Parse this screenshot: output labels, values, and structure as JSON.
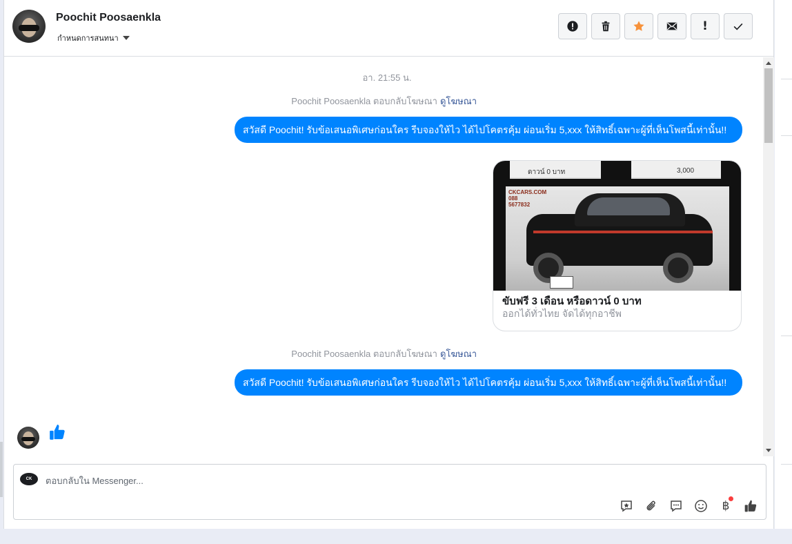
{
  "header": {
    "contact_name": "Poochit Poosaenkla",
    "assign_label": "กำหนดการสนทนา",
    "actions": [
      {
        "name": "spam-button",
        "icon": "alert-circle-icon"
      },
      {
        "name": "delete-button",
        "icon": "trash-icon"
      },
      {
        "name": "star-button",
        "icon": "star-icon"
      },
      {
        "name": "mark-unread-button",
        "icon": "envelope-icon"
      },
      {
        "name": "follow-up-button",
        "icon": "exclamation-icon"
      },
      {
        "name": "done-button",
        "icon": "check-icon"
      }
    ],
    "star_color": "#f7923b"
  },
  "thread": {
    "timestamp": "อา. 21:55 น.",
    "reply_note_1": {
      "text": "Poochit Poosaenkla ตอบกลับโฆษณา",
      "link": "ดูโฆษณา"
    },
    "message_1": "สวัสดี Poochit! รับข้อเสนอพิเศษก่อนใคร รีบจองให้ไว ได้ไปโคตรคุ้ม ผ่อนเริ่ม 5,xxx  ให้สิทธิ์เฉพาะผู้ที่เห็นโพสนี้เท่านั้น!!",
    "ad_card": {
      "strip_left": "ดาวน์ 0 บาท",
      "strip_right": "3,000",
      "logo_text": "CKCARS.COM 088 5677832",
      "title": "ขับฟรี 3 เดือน หรือดาวน์ 0 บาท",
      "subtitle": "ออกได้ทั่วไทย จัดได้ทุกอาชีพ"
    },
    "reply_note_2": {
      "text": "Poochit Poosaenkla ตอบกลับโฆษณา",
      "link": "ดูโฆษณา"
    },
    "message_2": "สวัสดี Poochit! รับข้อเสนอพิเศษก่อนใคร รีบจองให้ไว ได้ไปโคตรคุ้ม ผ่อนเริ่ม 5,xxx  ให้สิทธิ์เฉพาะผู้ที่เห็นโพสนี้เท่านั้น!!",
    "incoming_like": "thumbs-up-icon",
    "bubble_color": "#0084ff"
  },
  "composer": {
    "page_logo_text": "CK",
    "placeholder": "ตอบกลับใน Messenger...",
    "tools": [
      "saved-reply-icon",
      "attach-icon",
      "chat-bubble-icon",
      "emoji-icon",
      "baht-payment-icon",
      "thumbs-up-icon"
    ],
    "baht_symbol": "฿"
  }
}
